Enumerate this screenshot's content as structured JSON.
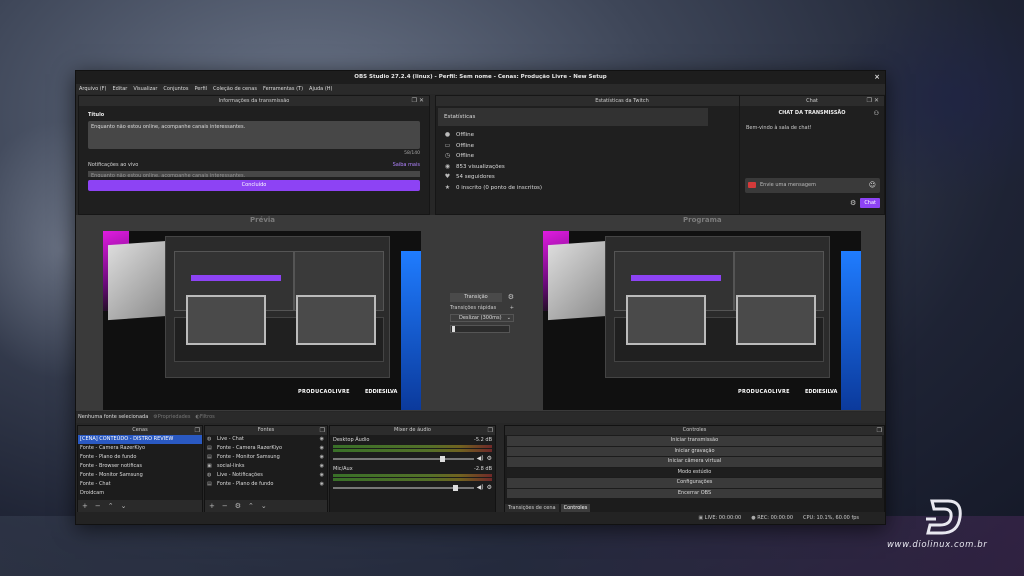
{
  "window": {
    "title": "OBS Studio 27.2.4 (linux) - Perfil: Sem nome - Cenas: Produção Livre - New Setup",
    "close": "×"
  },
  "menu": [
    "Arquivo (F)",
    "Editar",
    "Visualizar",
    "Conjuntos",
    "Perfil",
    "Coleção de cenas",
    "Ferramentas (T)",
    "Ajuda (H)"
  ],
  "info": {
    "header": "Informações da transmissão",
    "title_label": "Título",
    "title_value": "Enquanto não estou online, acompanhe canais interessantes.",
    "count": "58/140",
    "notif_label": "Notificações ao vivo",
    "more": "Saiba mais",
    "notif_value": "Enquanto não estou online, acompanhe canais interessantes.",
    "done": "Concluído"
  },
  "stats": {
    "header": "Estatísticas da Twitch",
    "sub": "Estatísticas",
    "items": [
      {
        "icon": "person-icon",
        "glyph": "👤",
        "text": "Offline"
      },
      {
        "icon": "video-icon",
        "glyph": "▭",
        "text": "Offline"
      },
      {
        "icon": "clock-icon",
        "glyph": "◷",
        "text": "Offline"
      },
      {
        "icon": "eye-icon",
        "glyph": "◉",
        "text": "853 visualizações"
      },
      {
        "icon": "heart-icon",
        "glyph": "♥",
        "text": "54 seguidores"
      },
      {
        "icon": "star-icon",
        "glyph": "★",
        "text": "0 inscrito (0 ponto de inscritos)"
      }
    ]
  },
  "chat": {
    "header": "Chat",
    "title": "CHAT DA TRANSMISSÃO",
    "welcome": "Bem-vindo à sala de chat!",
    "input_placeholder": "Envie uma mensagem",
    "send": "Chat"
  },
  "preview": {
    "label": "Prévia",
    "brand": "PRODUCAOLIVRE",
    "brand2": "EDDIESILVA"
  },
  "program": {
    "label": "Programa"
  },
  "transition": {
    "button": "Transição",
    "quick": "Transições rápidas",
    "select": "Deslizar (300ms)"
  },
  "sourcebar": {
    "none": "Nenhuma fonte selecionada",
    "props": "Propriedades",
    "filters": "Filtros"
  },
  "scenes": {
    "header": "Cenas",
    "items": [
      "[CENA] CONTEÚDO - DISTRO REVIEW",
      "Fonte - Camera RazerKiyo",
      "Fonte - Plano de fundo",
      "Fonte - Browser notificas",
      "Fonte - Monitor Samsung",
      "Fonte - Chat",
      "Droidcam"
    ]
  },
  "sources": {
    "header": "Fontes",
    "items": [
      "Live - Chat",
      "Fonte - Camera RazerKiyo",
      "Fonte - Monitor Samsung",
      "social-links",
      "Live - Notificações",
      "Fonte - Plano de fundo"
    ]
  },
  "mixer": {
    "header": "Mixer de áudio",
    "tracks": [
      {
        "name": "Desktop Áudio",
        "db": "-5.2 dB"
      },
      {
        "name": "Mic/Aux",
        "db": "-2.8 dB"
      }
    ]
  },
  "controls": {
    "header": "Controles",
    "buttons": [
      "Iniciar transmissão",
      "Iniciar gravação",
      "Iniciar câmera virtual",
      "Modo estúdio",
      "Configurações",
      "Encerrar OBS"
    ],
    "tabs": [
      "Transições de cena",
      "Controles"
    ]
  },
  "status": {
    "live": "LIVE: 00:00:00",
    "rec": "REC: 00:00:00",
    "cpu": "CPU: 10.1%, 60.00 fps"
  },
  "watermark": {
    "site": "www.diolinux.com.br"
  }
}
